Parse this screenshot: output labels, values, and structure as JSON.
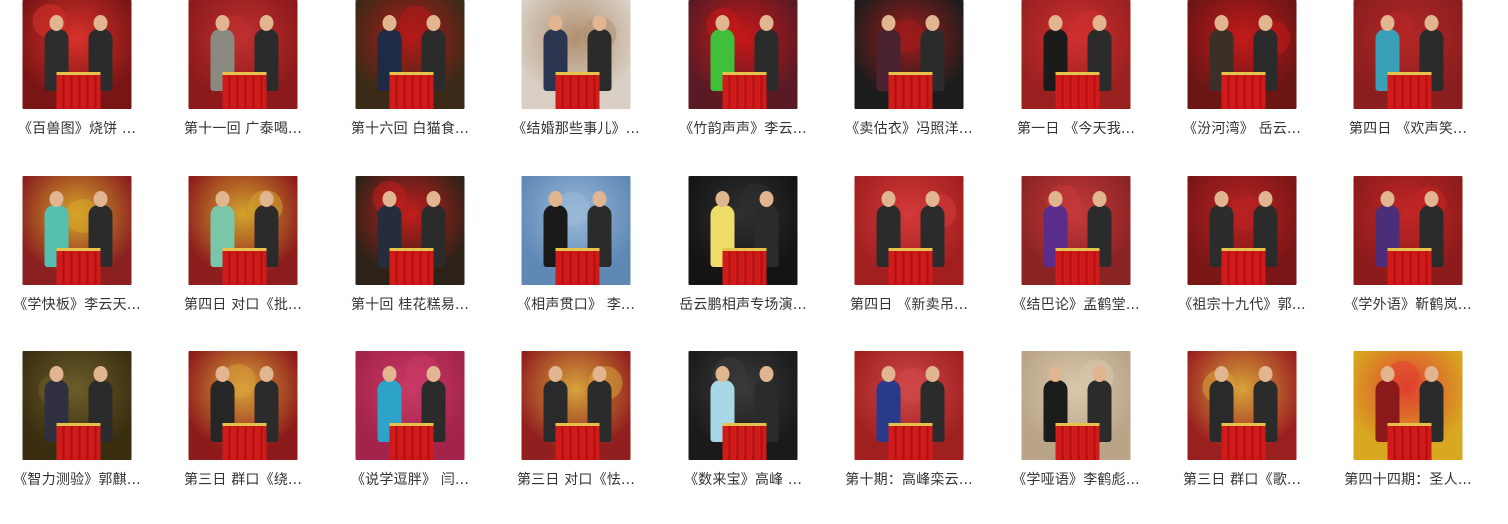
{
  "items": [
    {
      "title": "《百兽图》烧饼 ...",
      "palette": {
        "bg": "#7a1515",
        "accent": "#d9322a",
        "fig": "#2d2d2d"
      }
    },
    {
      "title": "第十一回 广泰喝...",
      "palette": {
        "bg": "#8c1a1a",
        "accent": "#c03030",
        "fig": "#8a8a80"
      }
    },
    {
      "title": "第十六回 白猫食...",
      "palette": {
        "bg": "#3b2a17",
        "accent": "#b41919",
        "fig": "#1f2a44"
      }
    },
    {
      "title": "《结婚那些事儿》...",
      "palette": {
        "bg": "#d9cfc4",
        "accent": "#b09070",
        "fig": "#2a3550"
      }
    },
    {
      "title": "《竹韵声声》李云...",
      "palette": {
        "bg": "#5a1a24",
        "accent": "#c81818",
        "fig": "#3fbf3a"
      }
    },
    {
      "title": "《卖估衣》冯照洋...",
      "palette": {
        "bg": "#1c1c1c",
        "accent": "#a01c1c",
        "fig": "#4a2230"
      }
    },
    {
      "title": "第一日 《今天我...",
      "palette": {
        "bg": "#9a2020",
        "accent": "#d03030",
        "fig": "#1b1b1b"
      }
    },
    {
      "title": "《汾河湾》 岳云...",
      "palette": {
        "bg": "#6b1515",
        "accent": "#c41a1a",
        "fig": "#3a3028"
      }
    },
    {
      "title": "第四日 《欢声笑...",
      "palette": {
        "bg": "#8a1e1e",
        "accent": "#b52727",
        "fig": "#3aa0b8"
      }
    },
    {
      "title": "《学快板》李云天...",
      "palette": {
        "bg": "#8a2020",
        "accent": "#d6a42a",
        "fig": "#55c0b0"
      }
    },
    {
      "title": "第四日 对口《批...",
      "palette": {
        "bg": "#8d1d1d",
        "accent": "#d4a42c",
        "fig": "#79c6a8"
      }
    },
    {
      "title": "第十回 桂花糕易...",
      "palette": {
        "bg": "#2d2218",
        "accent": "#c41d1d",
        "fig": "#252c3c"
      }
    },
    {
      "title": "《相声贯口》 李...",
      "palette": {
        "bg": "#5f88b5",
        "accent": "#9ab9d9",
        "fig": "#1a1a1a"
      }
    },
    {
      "title": "岳云鹏相声专场演...",
      "palette": {
        "bg": "#141414",
        "accent": "#303030",
        "fig": "#efdc6a"
      }
    },
    {
      "title": "第四日 《新卖吊...",
      "palette": {
        "bg": "#a21f1f",
        "accent": "#d43a3a",
        "fig": "#2b2b2b"
      }
    },
    {
      "title": "《结巴论》孟鹤堂...",
      "palette": {
        "bg": "#8a2323",
        "accent": "#c63a3a",
        "fig": "#5a2d8a"
      }
    },
    {
      "title": "《祖宗十九代》郭...",
      "palette": {
        "bg": "#7a1616",
        "accent": "#b92222",
        "fig": "#2c2c2c"
      }
    },
    {
      "title": "《学外语》靳鹤岚...",
      "palette": {
        "bg": "#8c1b1b",
        "accent": "#c42626",
        "fig": "#4b2d7a"
      }
    },
    {
      "title": "《智力测验》郭麒...",
      "palette": {
        "bg": "#3a2e10",
        "accent": "#6b5d2a",
        "fig": "#303040"
      }
    },
    {
      "title": "第三日 群口《绕...",
      "palette": {
        "bg": "#8e1b1b",
        "accent": "#d8a13a",
        "fig": "#262626"
      }
    },
    {
      "title": "《说学逗胖》 闫...",
      "palette": {
        "bg": "#a3234a",
        "accent": "#c83a66",
        "fig": "#2ea3c9"
      }
    },
    {
      "title": "第三日 对口《怯...",
      "palette": {
        "bg": "#921f1f",
        "accent": "#d6a33a",
        "fig": "#2a2a2a"
      }
    },
    {
      "title": "《数来宝》高峰 ...",
      "palette": {
        "bg": "#1a1a1a",
        "accent": "#3a3a3a",
        "fig": "#a8d8e6"
      }
    },
    {
      "title": "第十期：高峰栾云...",
      "palette": {
        "bg": "#a02020",
        "accent": "#d04848",
        "fig": "#2a3a8a"
      }
    },
    {
      "title": "《学哑语》李鹤彪...",
      "palette": {
        "bg": "#b9a488",
        "accent": "#d9c8ac",
        "fig": "#1c1c1c"
      }
    },
    {
      "title": "第三日 群口《歌...",
      "palette": {
        "bg": "#9a2020",
        "accent": "#d8a23a",
        "fig": "#2a2a2a"
      }
    },
    {
      "title": "第四十四期：圣人...",
      "palette": {
        "bg": "#d8a820",
        "accent": "#e04030",
        "fig": "#8a1a1a"
      }
    }
  ]
}
